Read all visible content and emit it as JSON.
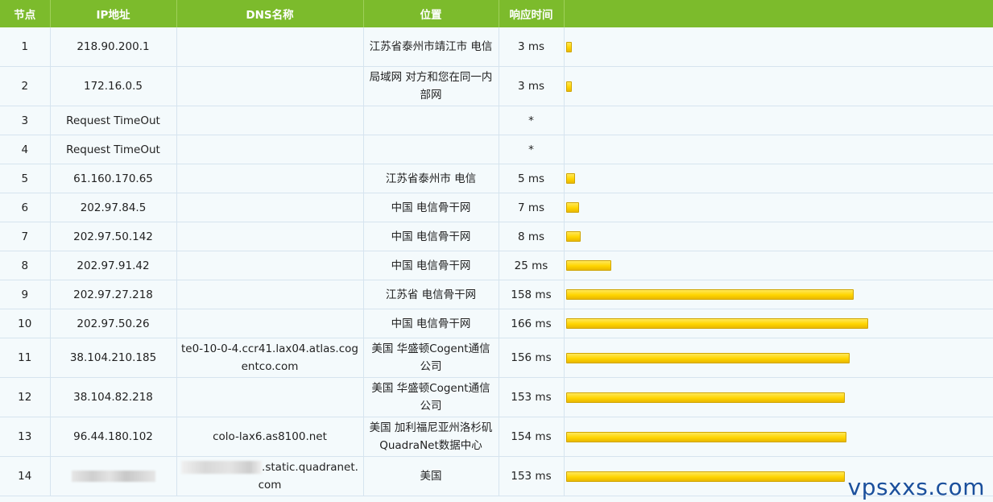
{
  "headers": {
    "node": "节点",
    "ip": "IP地址",
    "dns": "DNS名称",
    "location": "位置",
    "response": "响应时间"
  },
  "max_ms": 166,
  "rows": [
    {
      "node": "1",
      "ip": "218.90.200.1",
      "dns": "",
      "location": "江苏省泰州市靖江市 电信",
      "time": "3 ms",
      "ms": 3
    },
    {
      "node": "2",
      "ip": "172.16.0.5",
      "dns": "",
      "location": "局域网 对方和您在同一内部网",
      "time": "3 ms",
      "ms": 3
    },
    {
      "node": "3",
      "ip": "Request TimeOut",
      "dns": "",
      "location": "",
      "time": "*",
      "ms": null
    },
    {
      "node": "4",
      "ip": "Request TimeOut",
      "dns": "",
      "location": "",
      "time": "*",
      "ms": null
    },
    {
      "node": "5",
      "ip": "61.160.170.65",
      "dns": "",
      "location": "江苏省泰州市 电信",
      "time": "5 ms",
      "ms": 5
    },
    {
      "node": "6",
      "ip": "202.97.84.5",
      "dns": "",
      "location": "中国 电信骨干网",
      "time": "7 ms",
      "ms": 7
    },
    {
      "node": "7",
      "ip": "202.97.50.142",
      "dns": "",
      "location": "中国 电信骨干网",
      "time": "8 ms",
      "ms": 8
    },
    {
      "node": "8",
      "ip": "202.97.91.42",
      "dns": "",
      "location": "中国 电信骨干网",
      "time": "25 ms",
      "ms": 25
    },
    {
      "node": "9",
      "ip": "202.97.27.218",
      "dns": "",
      "location": "江苏省 电信骨干网",
      "time": "158 ms",
      "ms": 158
    },
    {
      "node": "10",
      "ip": "202.97.50.26",
      "dns": "",
      "location": "中国 电信骨干网",
      "time": "166 ms",
      "ms": 166
    },
    {
      "node": "11",
      "ip": "38.104.210.185",
      "dns": "te0-10-0-4.ccr41.lax04.atlas.cogentco.com",
      "location": "美国 华盛顿Cogent通信公司",
      "time": "156 ms",
      "ms": 156
    },
    {
      "node": "12",
      "ip": "38.104.82.218",
      "dns": "",
      "location": "美国 华盛顿Cogent通信公司",
      "time": "153 ms",
      "ms": 153
    },
    {
      "node": "13",
      "ip": "96.44.180.102",
      "dns": "colo-lax6.as8100.net",
      "location": "美国 加利福尼亚州洛杉矶QuadraNet数据中心",
      "time": "154 ms",
      "ms": 154
    },
    {
      "node": "14",
      "ip": "",
      "ip_redacted": true,
      "dns": ".static.quadranet.com",
      "dns_redacted_prefix": true,
      "location": "美国",
      "time": "153 ms",
      "ms": 153
    }
  ],
  "row_heights": [
    49,
    49,
    36,
    36,
    36,
    36,
    36,
    36,
    36,
    36,
    49,
    49,
    49,
    49
  ],
  "watermark": "vpsxxs.com",
  "colors": {
    "header_bg": "#7cbb2c",
    "bar_fill": "#ffd500",
    "row_bg": "#f4fafc"
  }
}
